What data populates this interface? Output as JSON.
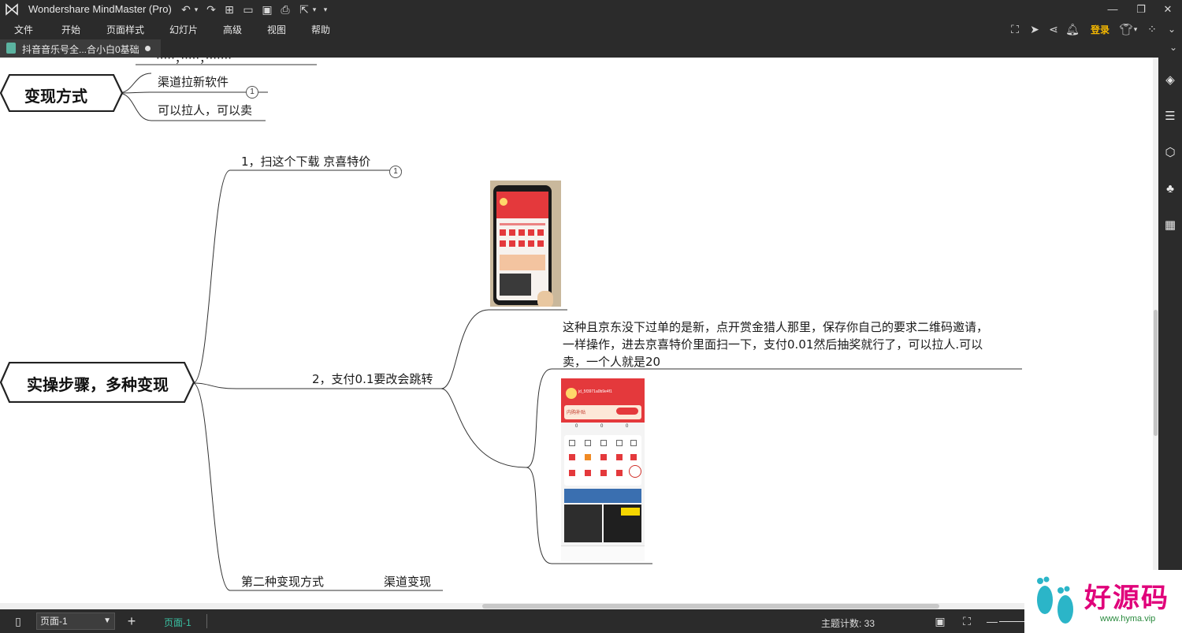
{
  "titlebar": {
    "app_title": "Wondershare MindMaster (Pro)",
    "quick_access": [
      "undo-icon",
      "redo-icon",
      "new-icon",
      "open-icon",
      "save-icon",
      "print-icon",
      "export-icon",
      "customize-icon"
    ],
    "window_controls": [
      "minimize-icon",
      "restore-icon",
      "close-icon"
    ]
  },
  "menubar": {
    "items": [
      "文件",
      "开始",
      "页面样式",
      "幻灯片",
      "高级",
      "视图",
      "帮助"
    ],
    "right_icons": [
      "fullscreen-icon",
      "send-icon",
      "share-icon",
      "bell-icon"
    ],
    "login_label": "登录",
    "login_color": "#f5b800",
    "extra_icons": [
      "shirt-icon",
      "apps-icon",
      "collapse-icon"
    ]
  },
  "tabbar": {
    "doc_tab_label": "抖音音乐号全...合小白0基础"
  },
  "mindmap": {
    "partial_top_text": "·····，·····，·······",
    "topic_monetize": "变现方式",
    "branch_channel": "渠道拉新软件",
    "branch_channel_badge": "1",
    "branch_recruit": "可以拉人，可以卖",
    "topic_steps": "实操步骤，多种变现",
    "step1": "1，扫这个下载 京喜特价",
    "step1_badge": "1",
    "step2": "2，支付0.1要改会跳转",
    "note_text": "这种且京东没下过单的是新，点开赏金猎人那里，保存你自己的要求二维码邀请，一样操作，进去京喜特价里面扫一下，支付0.01然后抽奖就行了，可以拉人.可以卖，一个人就是20",
    "note_line1": "这种且京东没下过单的是新，点开赏金猎人那里，保存你自己的要求二维码邀请，",
    "note_line2": "一样操作，进去京喜特价里面扫一下，支付0.01然后抽奖就行了，可以拉人.可以",
    "note_line3": "卖，一个人就是20",
    "second_method": "第二种变现方式",
    "channel_monetize": "渠道变现"
  },
  "app_screenshot": {
    "username": "jd_5f3971a0b9e4f1",
    "coupon_text": "内购补贴",
    "counters": [
      "0",
      "0",
      "0"
    ]
  },
  "rightbar": {
    "icons": [
      "format-paint-icon",
      "outline-list-icon",
      "shield-icon",
      "clover-icon",
      "calendar-check-icon"
    ]
  },
  "statusbar": {
    "page_select": "页面-1",
    "add_page": "+",
    "page_tab": "页面-1",
    "topic_count": "主题计数:  33",
    "icons": [
      "fit-page-icon",
      "fullscreen-icon",
      "zoom-out-icon"
    ]
  },
  "watermark": {
    "text": "好源码",
    "url": "www.hyma.vip"
  },
  "colors": {
    "chrome_bg": "#2b2b2b",
    "accent_green": "#39c0a2",
    "jd_red": "#e4393c"
  }
}
